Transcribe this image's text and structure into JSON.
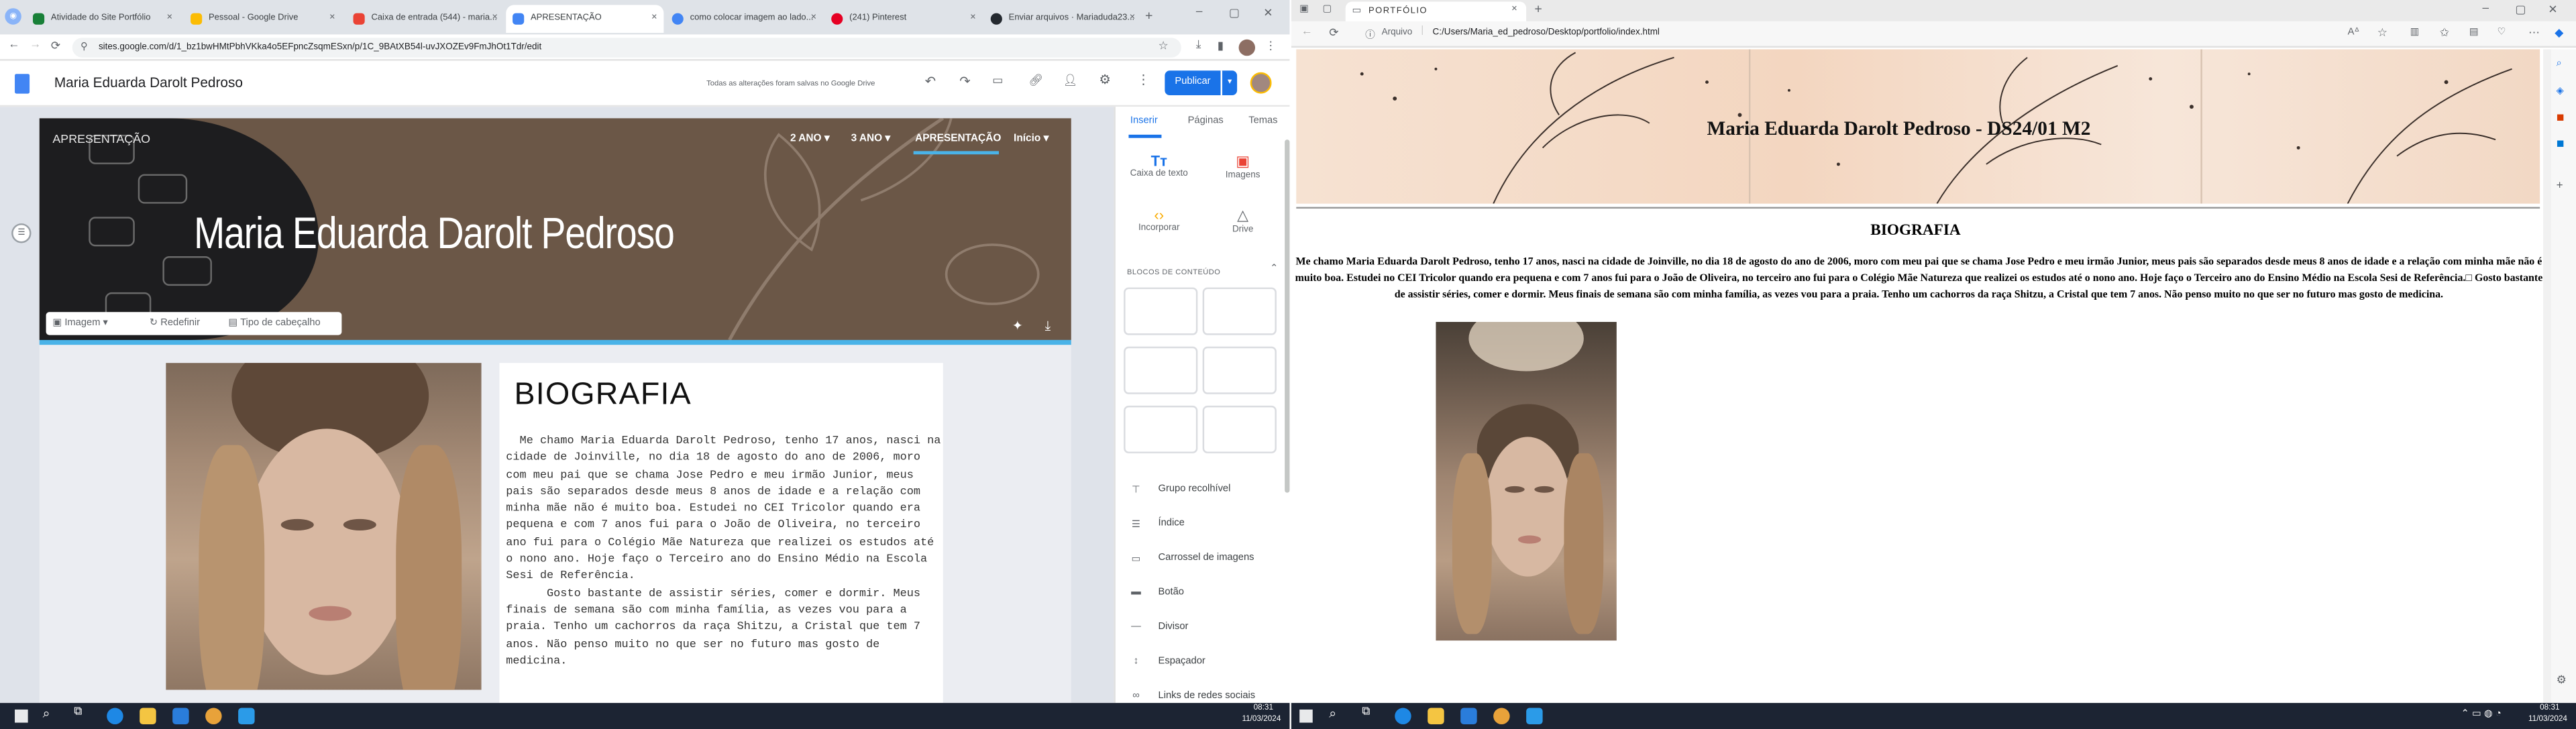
{
  "left_browser": {
    "tabs": [
      {
        "label": "Atividade do Site Portfólio",
        "color": "#188038"
      },
      {
        "label": "Pessoal - Google Drive",
        "color": "#fbbc04"
      },
      {
        "label": "Caixa de entrada (544) - maria...",
        "color": "#ea4335"
      },
      {
        "label": "APRESENTAÇÃO",
        "color": "#4285f4"
      },
      {
        "label": "como colocar imagem ao lado...",
        "color": "#4285f4"
      },
      {
        "label": "(241) Pinterest",
        "color": "#e60023"
      },
      {
        "label": "Enviar arquivos · Mariaduda23...",
        "color": "#24292f"
      }
    ],
    "active_tab_index": 3,
    "url": "sites.google.com/d/1_bz1bwHMtPbhVKka4o5EFpncZsqmESxn/p/1C_9BAtXB54l-uvJXOZEv9FmJhOt1Tdr/edit"
  },
  "sites_editor": {
    "site_title": "Maria Eduarda Darolt Pedroso",
    "save_status": "Todas as alterações foram salvas no Google Drive",
    "publish_label": "Publicar",
    "header": {
      "page_label": "APRESENTAÇÃO",
      "nav": [
        "2 ANO",
        "3 ANO",
        "APRESENTAÇÃO",
        "Início"
      ],
      "title": "Maria Eduarda Darolt Pedroso",
      "tools": [
        "Imagem",
        "Redefinir",
        "Tipo de cabeçalho"
      ]
    },
    "bio": {
      "heading": "BIOGRAFIA",
      "paragraph": "  Me chamo Maria Eduarda Darolt Pedroso, tenho 17 anos, nasci na cidade de Joinville, no dia 18 de agosto do ano de 2006, moro com meu pai que se chama Jose Pedro e meu irmão Junior, meus pais são separados desde meus 8 anos de idade e a relação com minha mãe não é muito boa. Estudei no CEI Tricolor quando era pequena e com 7 anos fui para o João de Oliveira, no terceiro ano fui para o Colégio Mãe Natureza que realizei os estudos até o nono ano. Hoje faço o Terceiro ano do Ensino Médio na Escola Sesi de Referência.\n      Gosto bastante de assistir séries, comer e dormir. Meus finais de semana são com minha família, as vezes vou para a praia. Tenho um cachorros da raça Shitzu, a Cristal que tem 7 anos. Não penso muito no que ser no futuro mas gosto de medicina."
    },
    "panel": {
      "tabs": [
        "Inserir",
        "Páginas",
        "Temas"
      ],
      "insert": [
        "Caixa de texto",
        "Imagens",
        "Incorporar",
        "Drive"
      ],
      "blocks_label": "BLOCOS DE CONTEÚDO",
      "items": [
        "Grupo recolhível",
        "Índice",
        "Carrossel de imagens",
        "Botão",
        "Divisor",
        "Espaçador",
        "Links de redes sociais"
      ]
    }
  },
  "right_browser": {
    "tab_title": "PORTFÓLIO",
    "address_prefix": "Arquivo",
    "url": "C:/Users/Maria_ed_pedroso/Desktop/portfolio/index.html",
    "banner_title": "Maria Eduarda Darolt Pedroso - DS24/01 M2",
    "heading": "BIOGRAFIA",
    "text": "Me chamo Maria Eduarda Darolt Pedroso, tenho 17 anos, nasci na cidade de Joinville, no dia 18 de agosto do ano de 2006, moro com meu pai que se chama Jose Pedro e meu irmão Junior, meus pais são separados desde meus 8 anos de idade e a relação com minha mãe não é muito boa. Estudei no CEI Tricolor quando era pequena e com 7 anos fui para o João de Oliveira, no terceiro ano fui para o Colégio Mãe Natureza que realizei os estudos até o nono ano. Hoje faço o Terceiro ano do Ensino Médio na Escola Sesi de Referência.□ Gosto bastante de assistir séries, comer e dormir. Meus finais de semana são com minha família, as vezes vou para a praia. Tenho um cachorros da raça Shitzu, a Cristal que tem 7 anos. Não penso muito no que ser no futuro mas gosto de medicina."
  },
  "taskbar": {
    "left_time": "08:31",
    "left_date": "11/03/2024",
    "right_time": "08:31",
    "right_date": "11/03/2024"
  }
}
